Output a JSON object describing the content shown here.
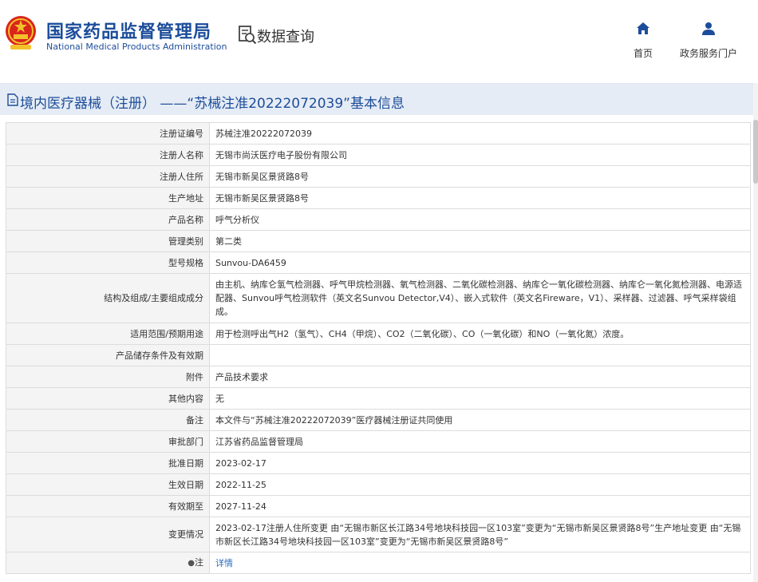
{
  "header": {
    "org_name_cn": "国家药品监督管理局",
    "org_name_en": "National Medical Products Administration",
    "query_title": "数据查询",
    "nav": [
      {
        "label": "首页",
        "icon": "home-icon"
      },
      {
        "label": "政务服务门户",
        "icon": "user-icon"
      }
    ]
  },
  "page_title": "境内医疗器械（注册） ——“苏械注准20222072039”基本信息",
  "fields": [
    {
      "key": "注册证编号",
      "value": "苏械注准20222072039"
    },
    {
      "key": "注册人名称",
      "value": "无锡市尚沃医疗电子股份有限公司"
    },
    {
      "key": "注册人住所",
      "value": "无锡市新吴区景贤路8号"
    },
    {
      "key": "生产地址",
      "value": "无锡市新吴区景贤路8号"
    },
    {
      "key": "产品名称",
      "value": "呼气分析仪"
    },
    {
      "key": "管理类别",
      "value": "第二类"
    },
    {
      "key": "型号规格",
      "value": "Sunvou-DA6459"
    },
    {
      "key": "结构及组成/主要组成成分",
      "value": "由主机、纳库仑氢气检测器、呼气甲烷检测器、氧气检测器、二氧化碳检测器、纳库仑一氧化碳检测器、纳库仑一氧化氮检测器、电源适配器、Sunvou呼气检测软件（英文名Sunvou Detector,V4）、嵌入式软件（英文名Fireware，V1）、采样器、过滤器、呼气采样袋组成。"
    },
    {
      "key": "适用范围/预期用途",
      "value": "用于检测呼出气H2（氢气）、CH4（甲烷）、CO2（二氧化碳）、CO（一氧化碳）和NO（一氧化氮）浓度。"
    },
    {
      "key": "产品储存条件及有效期",
      "value": ""
    },
    {
      "key": "附件",
      "value": "产品技术要求"
    },
    {
      "key": "其他内容",
      "value": "无"
    },
    {
      "key": "备注",
      "value": "本文件与“苏械注准20222072039”医疗器械注册证共同使用"
    },
    {
      "key": "审批部门",
      "value": "江苏省药品监督管理局"
    },
    {
      "key": "批准日期",
      "value": "2023-02-17"
    },
    {
      "key": "生效日期",
      "value": "2022-11-25"
    },
    {
      "key": "有效期至",
      "value": "2027-11-24"
    },
    {
      "key": "变更情况",
      "value": "2023-02-17注册人住所变更 由“无锡市新区长江路34号地块科技园一区103室”变更为“无锡市新吴区景贤路8号”生产地址变更 由“无锡市新区长江路34号地块科技园一区103室”变更为“无锡市新吴区景贤路8号”"
    },
    {
      "key": "注",
      "value": "详情"
    }
  ],
  "colors": {
    "brand_blue": "#1c4d9a",
    "title_bar_bg": "#e6ecf5",
    "label_bg": "#f4f4f4",
    "link": "#2b6dc0"
  }
}
